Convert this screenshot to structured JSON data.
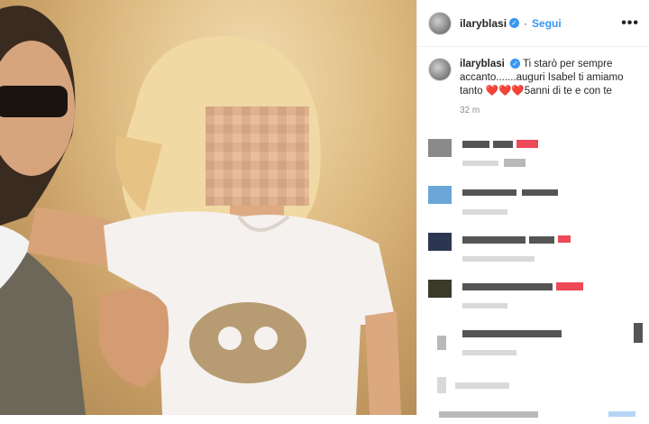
{
  "post": {
    "username": "ilaryblasi",
    "follow_label": "Segui",
    "more_icon": "•••",
    "caption": "Ti starò per sempre accanto.......auguri Isabel ti amiamo tanto ❤️❤️❤️5anni di te e con te",
    "time": "32 m"
  },
  "colors": {
    "link": "#3897f0",
    "heart": "#ed4956"
  }
}
